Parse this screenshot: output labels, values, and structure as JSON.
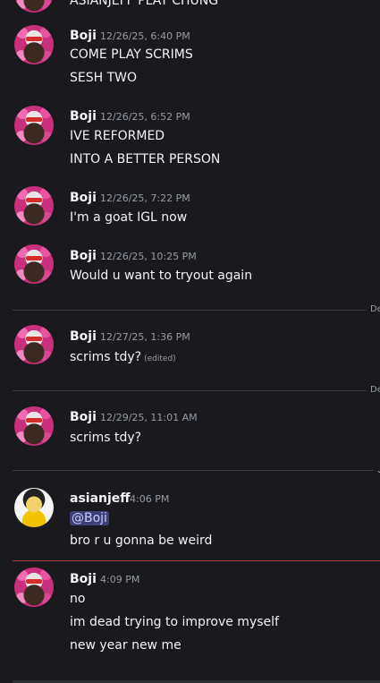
{
  "top_clip": {
    "text": "ASIANJEFF PLAY CHUNG"
  },
  "messages": [
    {
      "username": "Boji",
      "timestamp": "12/26/25, 6:40 PM",
      "lines": [
        "COME PLAY SCRIMS",
        "SESH TWO"
      ]
    },
    {
      "username": "Boji",
      "timestamp": "12/26/25, 6:52 PM",
      "lines": [
        "IVE REFORMED",
        "INTO A BETTER PERSON"
      ]
    },
    {
      "username": "Boji",
      "timestamp": "12/26/25, 7:22 PM",
      "lines": [
        "I'm a goat IGL now"
      ]
    },
    {
      "username": "Boji",
      "timestamp": "12/26/25, 10:25 PM",
      "lines": [
        "Would u want to tryout again"
      ]
    },
    {
      "username": "Boji",
      "timestamp": "12/27/25, 1:36 PM",
      "lines": [
        "scrims tdy?"
      ],
      "edited": "(edited)"
    },
    {
      "username": "Boji",
      "timestamp": "12/29/25, 11:01 AM",
      "lines": [
        "scrims tdy?"
      ]
    },
    {
      "username": "asianjeff",
      "timestamp": "4:06 PM",
      "mention": "@Boji",
      "lines": [
        "bro r u gonna be weird"
      ]
    },
    {
      "username": "Boji",
      "timestamp": "4:09 PM",
      "lines": [
        "no",
        "im dead trying to improve myself",
        "new year new me"
      ]
    }
  ],
  "dividers": [
    {
      "label": "De"
    },
    {
      "label": "De"
    },
    {
      "label": ""
    }
  ],
  "icons": {
    "avatar_boji": "boji-avatar",
    "avatar_jeff": "asianjeff-avatar",
    "chevron": "chevron-down-icon"
  },
  "colors": {
    "background": "#1a1a1e",
    "new_divider": "#a33a3a",
    "mention_bg": "#3d4175"
  }
}
